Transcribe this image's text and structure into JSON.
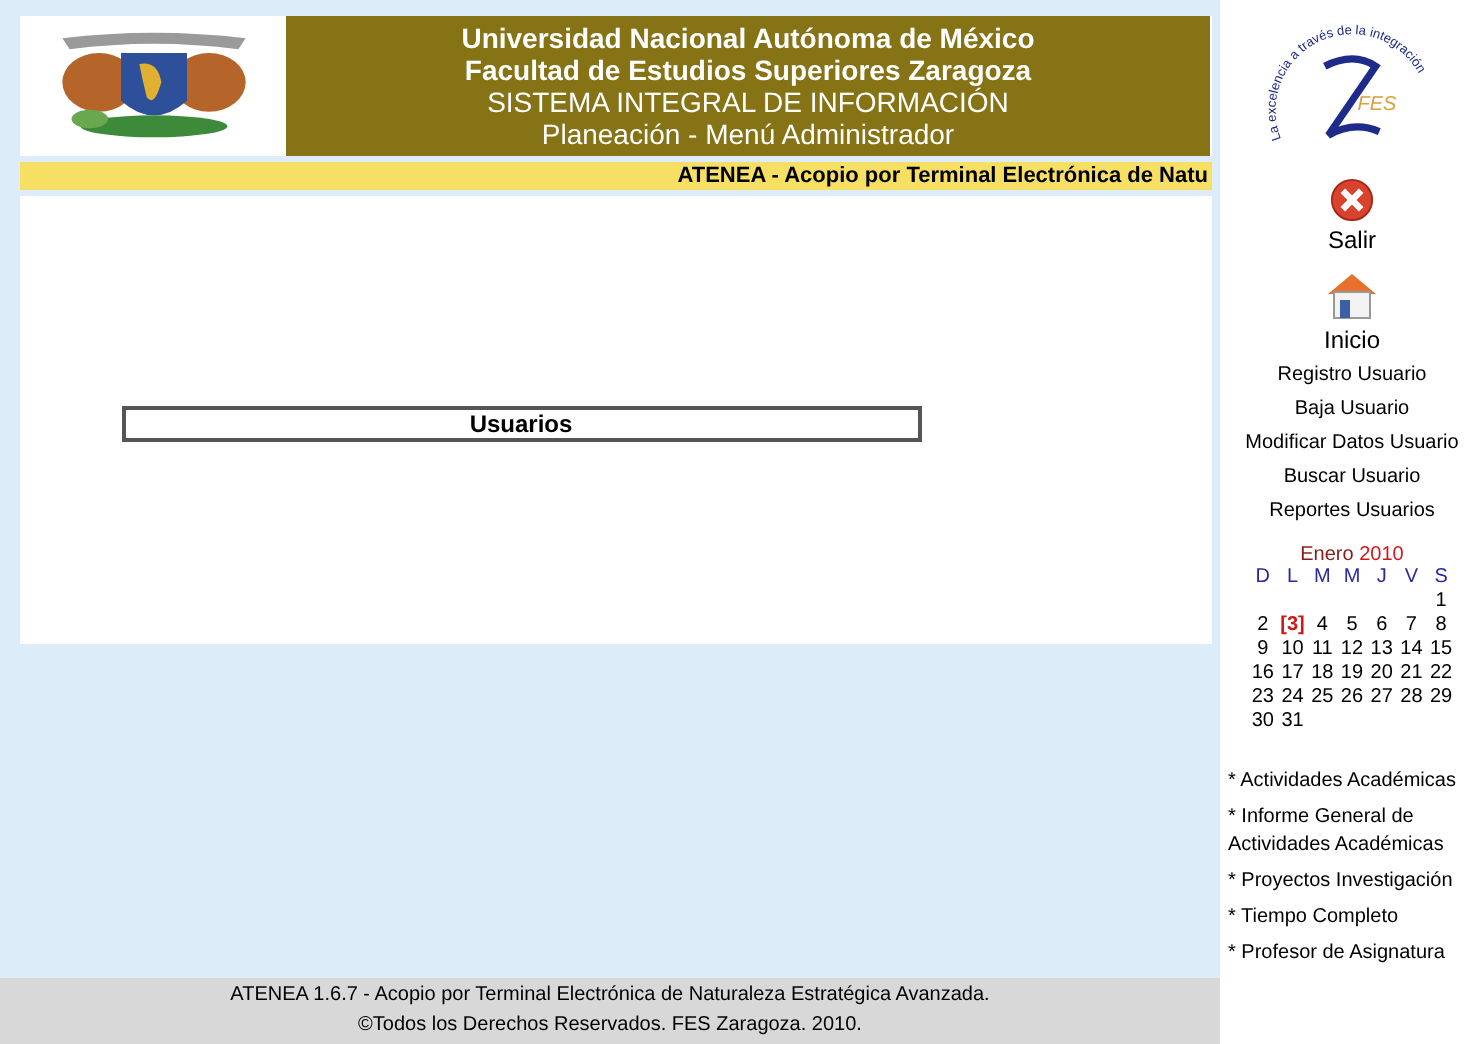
{
  "header": {
    "lines": [
      "Universidad Nacional Autónoma de México",
      "Facultad de Estudios Superiores Zaragoza",
      "SISTEMA INTEGRAL DE INFORMACIÓN",
      "Planeación - Menú Administrador"
    ]
  },
  "marquee": "ATENEA - Acopio por Terminal Electrónica de Natu",
  "panel": {
    "title": "Usuarios"
  },
  "logo": {
    "motto": "La excelencia a través de la integración",
    "letters": "FES"
  },
  "nav": [
    {
      "kind": "exit",
      "label": "Salir"
    },
    {
      "kind": "home",
      "label": "Inicio"
    }
  ],
  "menu": [
    "Registro Usuario",
    "Baja Usuario",
    "Modificar Datos Usuario",
    "Buscar Usuario",
    "Reportes Usuarios"
  ],
  "calendar": {
    "month": "Enero",
    "year": "2010",
    "weekdays": [
      "D",
      "L",
      "M",
      "M",
      "J",
      "V",
      "S"
    ],
    "weeks": [
      {
        "kind": "leading",
        "days": [
          {
            "day": "1",
            "today": false
          }
        ]
      },
      {
        "kind": "full",
        "days": [
          {
            "day": "2",
            "today": false
          },
          {
            "day": "[3]",
            "today": true
          },
          {
            "day": "4",
            "today": false
          },
          {
            "day": "5",
            "today": false
          },
          {
            "day": "6",
            "today": false
          },
          {
            "day": "7",
            "today": false
          },
          {
            "day": "8",
            "today": false
          }
        ]
      },
      {
        "kind": "full",
        "days": [
          {
            "day": "9",
            "today": false
          },
          {
            "day": "10",
            "today": false
          },
          {
            "day": "11",
            "today": false
          },
          {
            "day": "12",
            "today": false
          },
          {
            "day": "13",
            "today": false
          },
          {
            "day": "14",
            "today": false
          },
          {
            "day": "15",
            "today": false
          }
        ]
      },
      {
        "kind": "full",
        "days": [
          {
            "day": "16",
            "today": false
          },
          {
            "day": "17",
            "today": false
          },
          {
            "day": "18",
            "today": false
          },
          {
            "day": "19",
            "today": false
          },
          {
            "day": "20",
            "today": false
          },
          {
            "day": "21",
            "today": false
          },
          {
            "day": "22",
            "today": false
          }
        ]
      },
      {
        "kind": "full",
        "days": [
          {
            "day": "23",
            "today": false
          },
          {
            "day": "24",
            "today": false
          },
          {
            "day": "25",
            "today": false
          },
          {
            "day": "26",
            "today": false
          },
          {
            "day": "27",
            "today": false
          },
          {
            "day": "28",
            "today": false
          },
          {
            "day": "29",
            "today": false
          }
        ]
      },
      {
        "kind": "trailing",
        "days": [
          {
            "day": "30",
            "today": false
          },
          {
            "day": "31",
            "today": false
          }
        ]
      }
    ]
  },
  "links": [
    "* Actividades Académicas",
    "* Informe General de Actividades Académicas",
    "* Proyectos Investigación",
    "* Tiempo Completo",
    "* Profesor de Asignatura"
  ],
  "footer": [
    "ATENEA 1.6.7 - Acopio por Terminal Electrónica de Naturaleza Estratégica Avanzada.",
    "©Todos los Derechos Reservados. FES Zaragoza. 2010."
  ]
}
